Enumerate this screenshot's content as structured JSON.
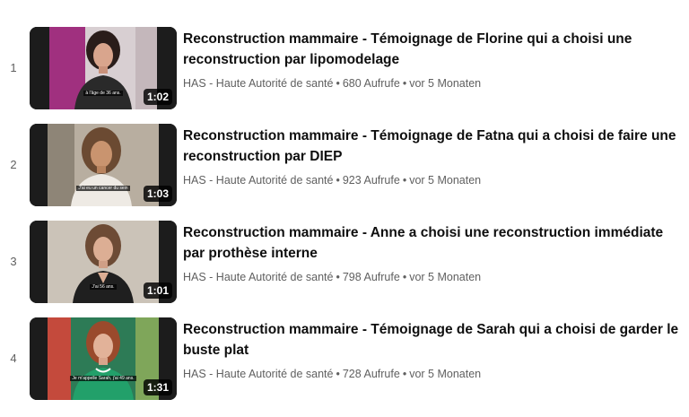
{
  "playlist": {
    "videos": [
      {
        "index": "1",
        "title": "Reconstruction mammaire - Témoignage de Florine qui a choisi une reconstruction par lipomodelage",
        "channel": "HAS - Haute Autorité de santé",
        "views": "680 Aufrufe",
        "age": "vor 5 Monaten",
        "duration": "1:02",
        "subtitle": "à l'âge de 36 ans."
      },
      {
        "index": "2",
        "title": "Reconstruction mammaire - Témoignage de Fatna qui a choisi de faire une reconstruction par DIEP",
        "channel": "HAS - Haute Autorité de santé",
        "views": "923 Aufrufe",
        "age": "vor 5 Monaten",
        "duration": "1:03",
        "subtitle": "J'ai eu un cancer du sein"
      },
      {
        "index": "3",
        "title": "Reconstruction mammaire - Anne a choisi une reconstruction immédiate par prothèse interne",
        "channel": "HAS - Haute Autorité de santé",
        "views": "798 Aufrufe",
        "age": "vor 5 Monaten",
        "duration": "1:01",
        "subtitle": "J'ai 56 ans."
      },
      {
        "index": "4",
        "title": "Reconstruction mammaire - Témoignage de Sarah qui a choisi de garder le buste plat",
        "channel": "HAS - Haute Autorité de santé",
        "views": "728 Aufrufe",
        "age": "vor 5 Monaten",
        "duration": "1:31",
        "subtitle": "Je m'appelle Sarah, j'ai 49 ans."
      }
    ],
    "separator": "•"
  },
  "colors": {
    "title_text": "#0f0f0f",
    "meta_text": "#606060",
    "duration_badge_bg": "#000000",
    "thumb1_backdrop": "#9b2a7e",
    "thumb2_backdrop": "#b9b1a4",
    "thumb3_backdrop": "#c9c2b8",
    "thumb4_backdrop": "#2c7a55"
  }
}
